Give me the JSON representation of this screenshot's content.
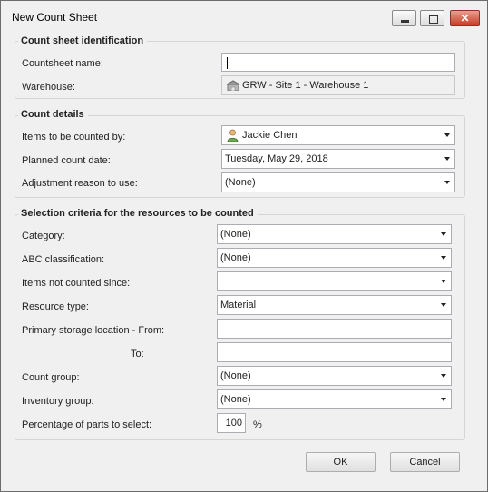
{
  "window": {
    "title": "New Count Sheet",
    "min_icon": "minimize-icon",
    "max_icon": "maximize-icon",
    "close_icon": "close-icon",
    "close_glyph": "✕"
  },
  "identification": {
    "title": "Count sheet identification",
    "countsheet_name_label": "Countsheet name:",
    "countsheet_name_value": "",
    "warehouse_label": "Warehouse:",
    "warehouse_value": "GRW - Site 1 - Warehouse 1"
  },
  "details": {
    "title": "Count details",
    "counted_by_label": "Items to be counted by:",
    "counted_by_value": "Jackie Chen",
    "planned_date_label": "Planned count date:",
    "planned_date_value": "Tuesday, May 29, 2018",
    "adjustment_reason_label": "Adjustment reason to use:",
    "adjustment_reason_value": "(None)"
  },
  "criteria": {
    "title": "Selection criteria for the resources to be counted",
    "category_label": "Category:",
    "category_value": "(None)",
    "abc_label": "ABC classification:",
    "abc_value": "(None)",
    "not_counted_label": "Items not counted since:",
    "not_counted_value": "",
    "resource_type_label": "Resource type:",
    "resource_type_value": "Material",
    "storage_from_label": "Primary storage location - From:",
    "storage_from_value": "",
    "storage_to_label": "To:",
    "storage_to_value": "",
    "count_group_label": "Count group:",
    "count_group_value": "(None)",
    "inventory_group_label": "Inventory group:",
    "inventory_group_value": "(None)",
    "percentage_label": "Percentage of parts to select:",
    "percentage_value": "100",
    "percentage_unit": "%"
  },
  "buttons": {
    "ok": "OK",
    "cancel": "Cancel"
  },
  "icons": {
    "warehouse": "warehouse-icon",
    "user": "user-icon"
  }
}
